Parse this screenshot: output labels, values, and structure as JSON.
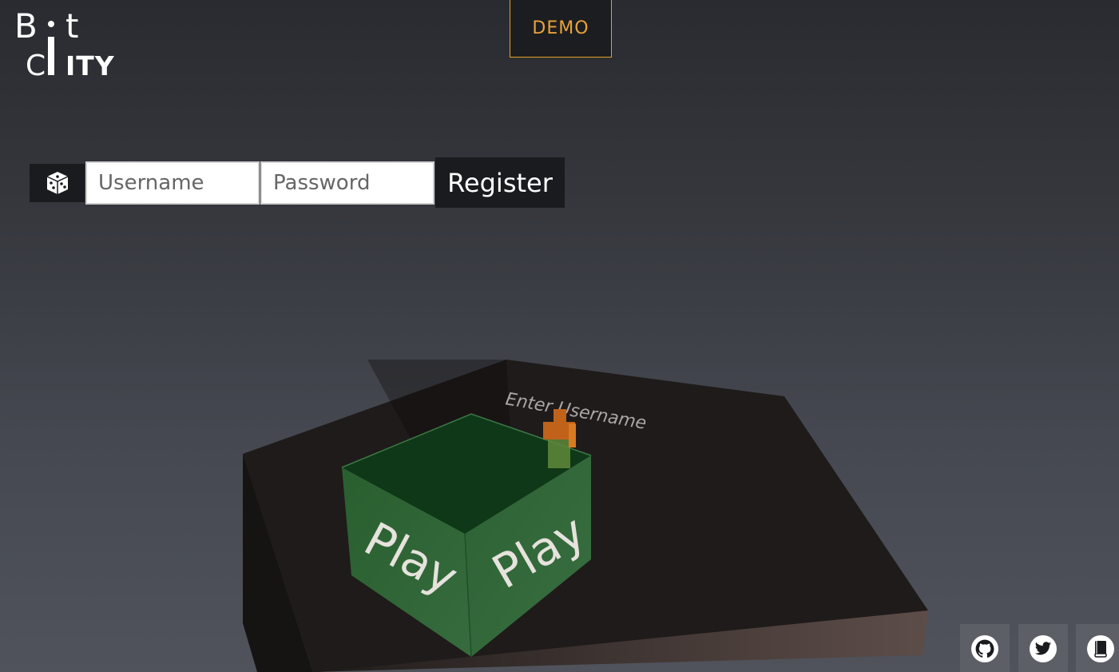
{
  "logo": {
    "letter_b": "B",
    "letter_t": "t",
    "letter_c": "C",
    "letters_ity": "ITY"
  },
  "header": {
    "demo_label": "DEMO"
  },
  "register_form": {
    "random_icon": "dice-icon",
    "username_placeholder": "Username",
    "password_placeholder": "Password",
    "register_label": "Register"
  },
  "scene": {
    "platform_text": "Enter Username",
    "cube_left_text": "Play",
    "cube_right_text": "Play"
  },
  "social_links": [
    {
      "icon": "github-icon"
    },
    {
      "icon": "twitter-icon"
    },
    {
      "icon": "book-icon"
    }
  ],
  "colors": {
    "accent": "#e0a126",
    "dark_button": "#1a1b1e",
    "platform": "#1e1a19",
    "cube": "#2e6b34"
  }
}
